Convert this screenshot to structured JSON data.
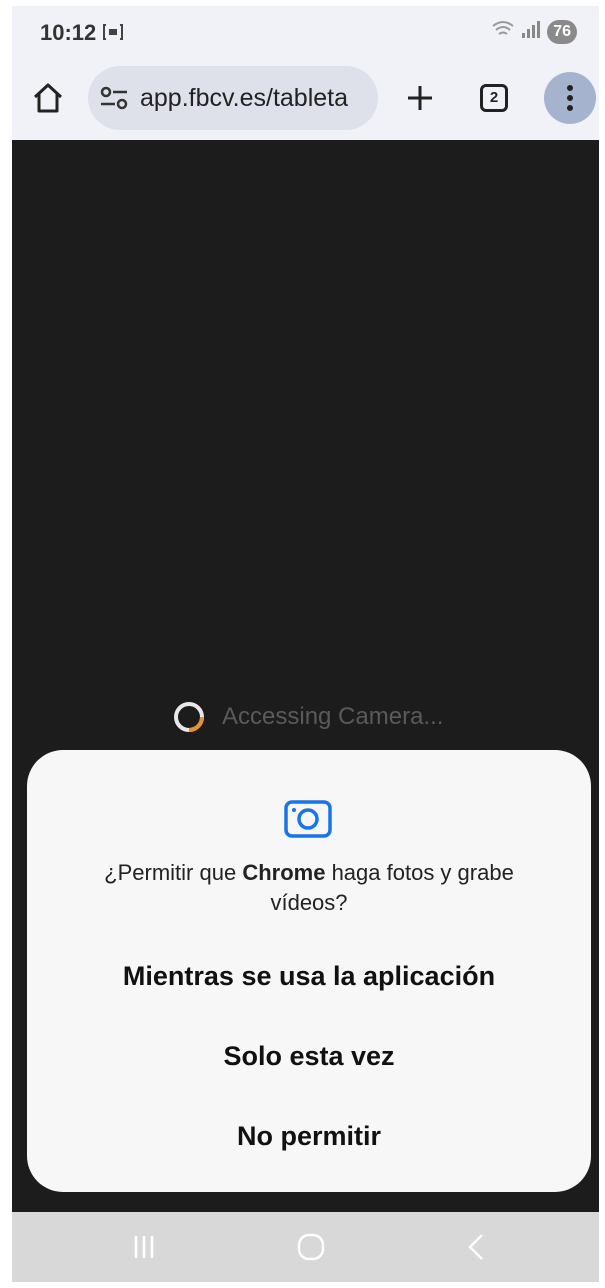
{
  "status_bar": {
    "time": "10:12",
    "battery": "76",
    "screencast_icon": "screencast-icon",
    "wifi_icon": "wifi-icon",
    "signal_icon": "signal-icon"
  },
  "browser": {
    "url": "app.fbcv.es/tableta",
    "tab_count": "2",
    "home_icon": "home-icon",
    "site_settings_icon": "tune-icon",
    "new_tab_icon": "plus-icon",
    "menu_icon": "more-vert-icon"
  },
  "page": {
    "loading_text": "Accessing Camera..."
  },
  "permission_dialog": {
    "icon": "camera-icon",
    "message_prefix": "¿Permitir que ",
    "app_name": "Chrome",
    "message_suffix": " haga fotos y grabe vídeos?",
    "options": [
      {
        "label": "Mientras se usa la aplicación"
      },
      {
        "label": "Solo esta vez"
      },
      {
        "label": "No permitir"
      }
    ]
  },
  "nav_bar": {
    "recents_icon": "recents-icon",
    "home_icon": "home-circle-icon",
    "back_icon": "back-icon"
  },
  "colors": {
    "accent": "#1a73e8",
    "spinner_accent": "#e8912a",
    "page_background": "#1c1c1c",
    "dialog_background": "#f7f7f7"
  }
}
